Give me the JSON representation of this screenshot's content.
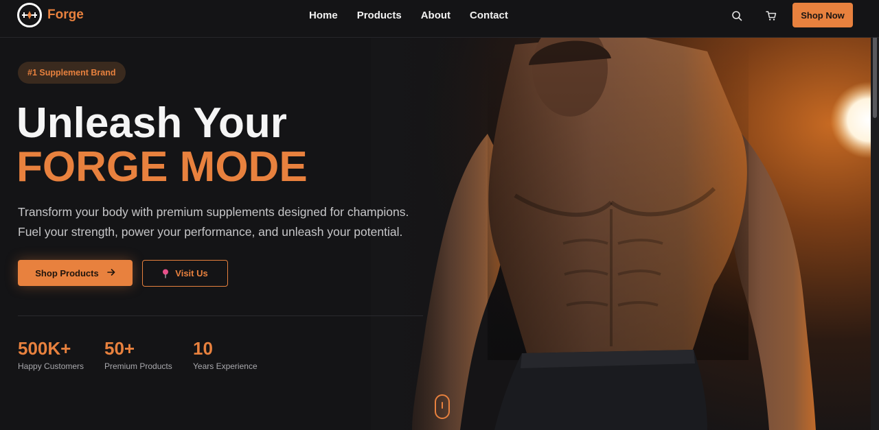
{
  "brand": {
    "name": "Forge"
  },
  "nav": {
    "links": [
      "Home",
      "Products",
      "About",
      "Contact"
    ],
    "cta": "Shop Now"
  },
  "hero": {
    "badge": "#1 Supplement Brand",
    "title_line1": "Unleash Your",
    "title_line2": "FORGE MODE",
    "subtitle": "Transform your body with premium supplements designed for champions. Fuel your strength, power your performance, and unleash your potential.",
    "primary_button": "Shop Products",
    "secondary_button": "Visit Us",
    "stats": [
      {
        "value": "500K+",
        "label": "Happy Customers"
      },
      {
        "value": "50+",
        "label": "Premium Products"
      },
      {
        "value": "10",
        "label": "Years Experience"
      }
    ]
  },
  "colors": {
    "accent": "#e8813e",
    "background": "#141416",
    "badge_bg": "#3a2a1e"
  },
  "icons": [
    "forge-logo-icon",
    "search-icon",
    "cart-icon",
    "arrow-right-icon",
    "map-pin-icon",
    "mouse-scroll-icon"
  ]
}
